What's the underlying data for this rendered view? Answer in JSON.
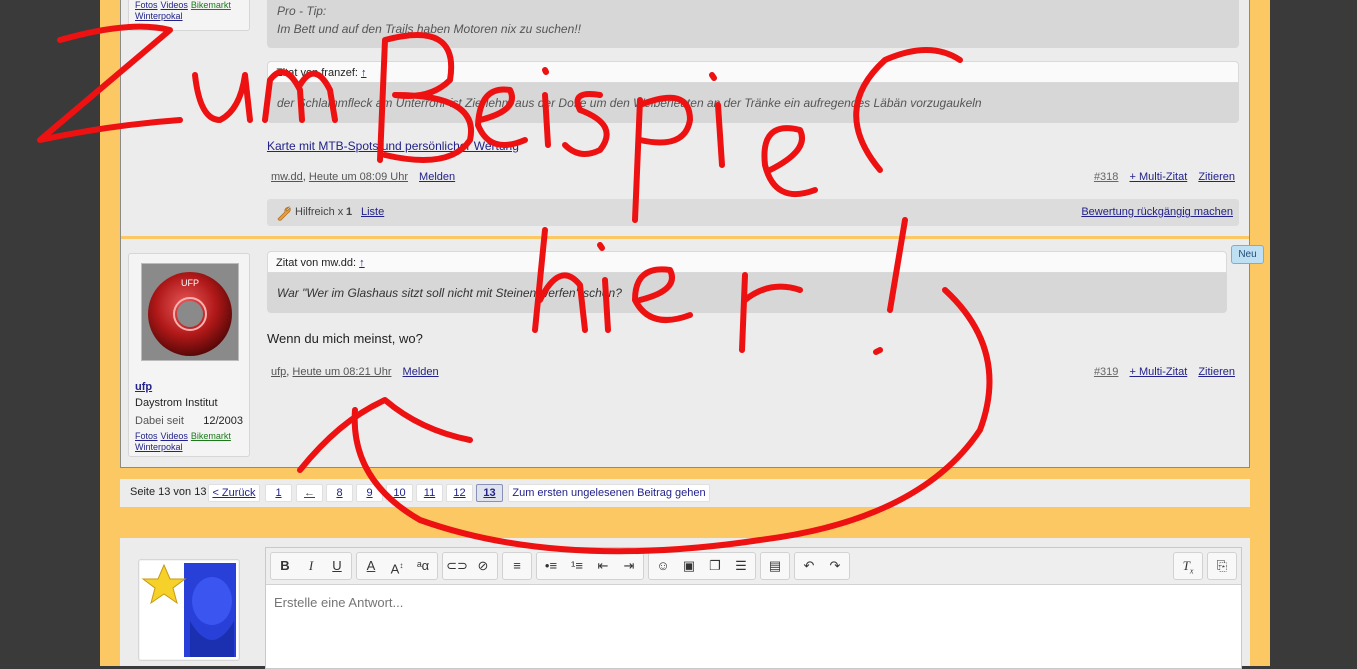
{
  "post1": {
    "user_links": [
      "Fotos",
      "Videos",
      "Bikemarkt",
      "Winterpokal"
    ],
    "quote1_line1": "Pro - Tip:",
    "quote1_line2": "Im Bett und auf den Trails haben Motoren nix zu suchen!!",
    "quote2_header": "Zitat von franzef:",
    "quote2_arrow": "↑",
    "quote2_text": "der Schlammfleck am Unterrohr ist Zierlehm aus der Dose um den Weiberleuten an der Tränke ein aufregendes Läbän vorzugaukeln",
    "signature_link": "Karte mit MTB-Spots und persönlicher Wertung",
    "author": "mw.dd",
    "time": "Heute um 08:09 Uhr",
    "report": "Melden",
    "post_number": "#318",
    "multi_quote": "+ Multi-Zitat",
    "quote_action": "Zitieren",
    "helpful_label": "Hilfreich x",
    "helpful_count": "1",
    "list_link": "Liste",
    "undo_rating": "Bewertung rückgängig machen"
  },
  "post2": {
    "username": "ufp",
    "user_title": "Daystrom Institut",
    "joined_label": "Dabei seit",
    "joined_value": "12/2003",
    "user_links": [
      "Fotos",
      "Videos",
      "Bikemarkt",
      "Winterpokal"
    ],
    "new_badge": "Neu",
    "quote_header": "Zitat von mw.dd:",
    "quote_arrow": "↑",
    "quote_text": "War \"Wer im Glashaus sitzt soll nicht mit Steinen werfen\" schon?",
    "message": "Wenn du mich meinst, wo?",
    "author": "ufp",
    "time": "Heute um 08:21 Uhr",
    "report": "Melden",
    "post_number": "#319",
    "multi_quote": "+ Multi-Zitat",
    "quote_action": "Zitieren"
  },
  "pagination": {
    "label": "Seite 13 von 13",
    "prev": "< Zurück",
    "pages": [
      "1",
      "←",
      "8",
      "9",
      "10",
      "11",
      "12",
      "13"
    ],
    "current": "13",
    "first_unread": "Zum ersten ungelesenen Beitrag gehen"
  },
  "editor": {
    "placeholder": "Erstelle eine Antwort..."
  },
  "annotation": {
    "line1": "Zum Beispiel",
    "line2": "hier !",
    "color": "#ee1111"
  },
  "icons": [
    "bold-icon",
    "italic-icon",
    "underline-icon",
    "text-color-icon",
    "font-size-icon",
    "font-family-icon",
    "link-icon",
    "unlink-icon",
    "align-icon",
    "bullet-list-icon",
    "number-list-icon",
    "outdent-icon",
    "indent-icon",
    "smiley-icon",
    "image-icon",
    "media-icon",
    "insert-icon",
    "save-draft-icon",
    "undo-icon",
    "redo-icon",
    "remove-format-icon",
    "toggle-bbcode-icon"
  ]
}
